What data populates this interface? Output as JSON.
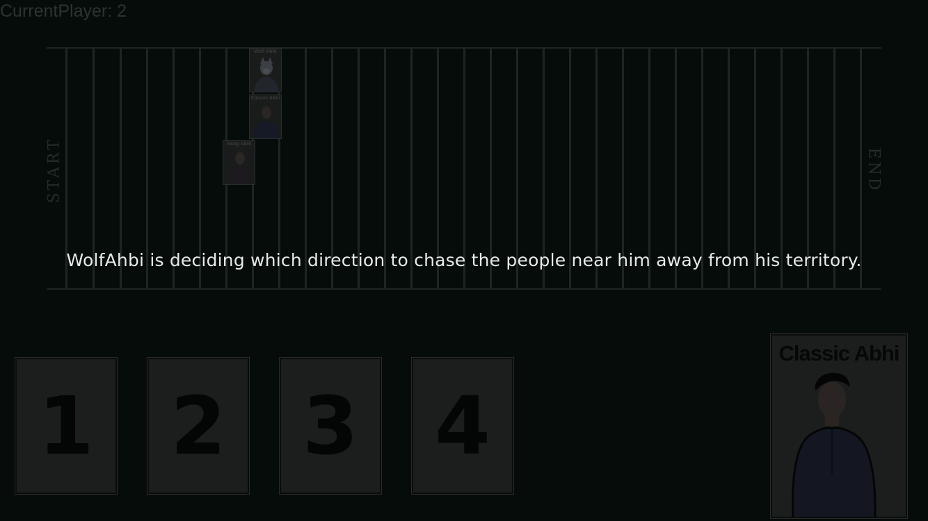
{
  "status": {
    "current_player": "CurrentPlayer: 2"
  },
  "board": {
    "start_label": "START",
    "end_label": "END",
    "tokens": [
      {
        "name": "Wolf Abhi"
      },
      {
        "name": "Classic Abhi"
      },
      {
        "name": "Swag Abhi"
      }
    ]
  },
  "message": "WolfAhbi is deciding which direction to chase the people near him away from his territory.",
  "hand": {
    "cards": [
      "1",
      "2",
      "3",
      "4"
    ]
  },
  "character_card": {
    "name": "Classic Abhi"
  }
}
